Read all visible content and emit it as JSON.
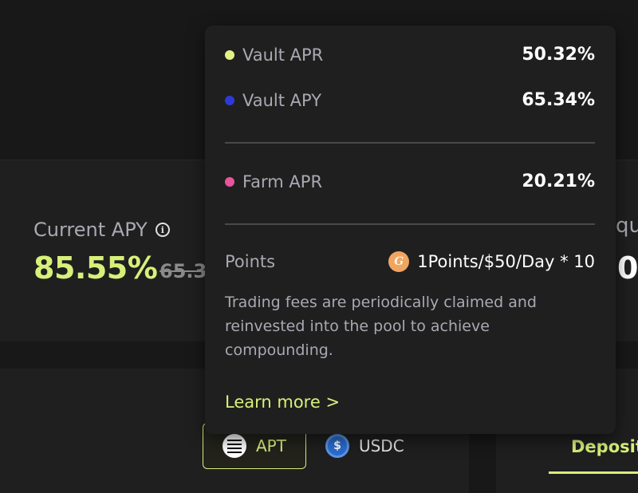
{
  "stats": {
    "current_apy_label": "Current APY",
    "current_apy_value": "85.55%",
    "current_apy_old": "65.3",
    "right_label": "qu",
    "right_value": "0"
  },
  "tooltip": {
    "rows": [
      {
        "label": "Vault APR",
        "value": "50.32%",
        "dot_color": "#e3f283"
      },
      {
        "label": "Vault APY",
        "value": "65.34%",
        "dot_color": "#2f39d6"
      },
      {
        "label": "Farm APR",
        "value": "20.21%",
        "dot_color": "#e8559a"
      }
    ],
    "points_label": "Points",
    "points_icon_glyph": "G",
    "points_value": "1Points/$50/Day * 10",
    "description": "Trading fees are periodically claimed and reinvested into the pool to achieve compounding.",
    "learn_more": "Learn more >"
  },
  "tokens": [
    {
      "label": "APT",
      "icon": "aptos-icon",
      "active": true
    },
    {
      "label": "USDC",
      "icon": "usdc-icon",
      "active": false
    }
  ],
  "deposit_tab": "Deposit",
  "colors": {
    "accent": "#d7f07a",
    "background": "#181818",
    "panel": "#1f1f1f"
  }
}
